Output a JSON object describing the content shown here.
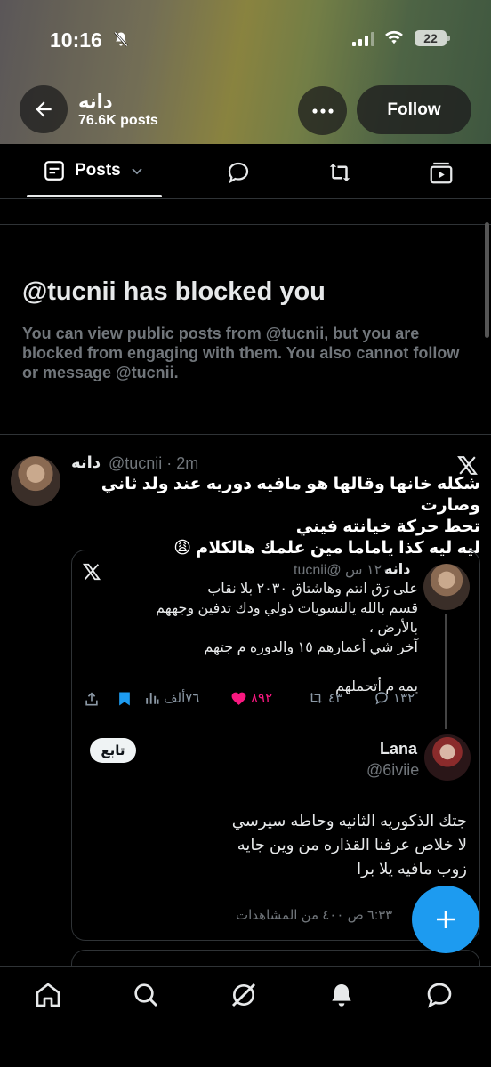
{
  "status_bar": {
    "time": "10:16",
    "battery": "22"
  },
  "header": {
    "name": "دانه",
    "posts_count": "76.6K posts",
    "follow_label": "Follow"
  },
  "tabs": {
    "posts_label": "Posts"
  },
  "blocked": {
    "title": "@tucnii has blocked you",
    "message": "You can view public posts from @tucnii, but you are blocked from engaging with them. You also cannot follow or message @tucnii."
  },
  "tweet": {
    "name": "دانه",
    "handle": "@tucnii · 2m",
    "lines": [
      "شكله خانها وقالها هو مافيه دوريه عند ولد ثاني وصارت",
      "تحط حركة خيانته فيني",
      "ليه ليه كذا ياماما مين علمك هالكلام 😩"
    ],
    "embed": {
      "name": "دانه",
      "meta": "١٢٠ س @tucnii",
      "lines": [
        "على رَق انتم وهاشتاق ٢٠٣٠ بلا نقاب",
        "قسم بالله يالنسويات ذولي ودك تدفين وجههم بالأرض ،",
        "آخر شي أعمارهم ١٥ والدوره م جتهم",
        "",
        "يمه م أتحملهم"
      ],
      "actions": {
        "replies": "١٣٢",
        "retweets": "٤٣",
        "likes": "٨٩٢",
        "views": "٧٦ألف"
      },
      "reply": {
        "follow_label": "تابع",
        "name": "Lana",
        "handle": "@6iviie",
        "lines": [
          "جتك الذكوريه الثانيه وحاطه سيرسي",
          "لا خلاص عرفنا القذاره من وين جايه",
          "زوب مافيه يلا برا"
        ],
        "views_line": "٦:٣٣ ص ٤٠٠ من المشاهدات"
      }
    }
  },
  "colors": {
    "accent": "#1d9bf0",
    "like": "#f91880",
    "muted": "#71767b"
  }
}
